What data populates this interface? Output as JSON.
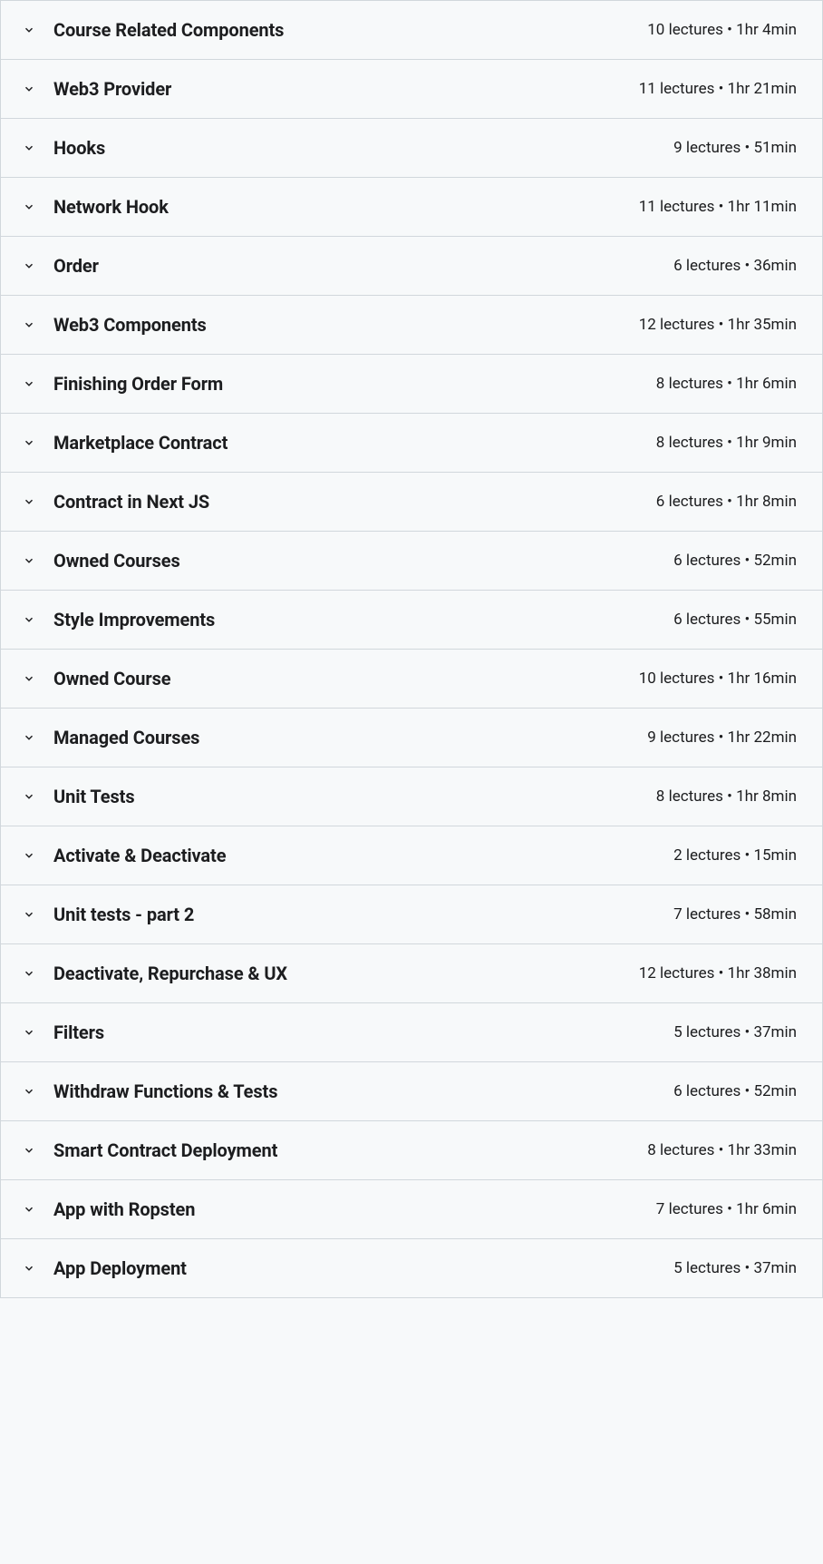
{
  "sections": [
    {
      "title": "Course Related Components",
      "meta": "10 lectures • 1hr 4min"
    },
    {
      "title": "Web3 Provider",
      "meta": "11 lectures • 1hr 21min"
    },
    {
      "title": "Hooks",
      "meta": "9 lectures • 51min"
    },
    {
      "title": "Network Hook",
      "meta": "11 lectures • 1hr 11min"
    },
    {
      "title": "Order",
      "meta": "6 lectures • 36min"
    },
    {
      "title": "Web3 Components",
      "meta": "12 lectures • 1hr 35min"
    },
    {
      "title": "Finishing Order Form",
      "meta": "8 lectures • 1hr 6min"
    },
    {
      "title": "Marketplace Contract",
      "meta": "8 lectures • 1hr 9min"
    },
    {
      "title": "Contract in Next JS",
      "meta": "6 lectures • 1hr 8min"
    },
    {
      "title": "Owned Courses",
      "meta": "6 lectures • 52min"
    },
    {
      "title": "Style Improvements",
      "meta": "6 lectures • 55min"
    },
    {
      "title": "Owned Course",
      "meta": "10 lectures • 1hr 16min"
    },
    {
      "title": "Managed Courses",
      "meta": "9 lectures • 1hr 22min"
    },
    {
      "title": "Unit Tests",
      "meta": "8 lectures • 1hr 8min"
    },
    {
      "title": "Activate & Deactivate",
      "meta": "2 lectures • 15min"
    },
    {
      "title": "Unit tests - part 2",
      "meta": "7 lectures • 58min"
    },
    {
      "title": "Deactivate, Repurchase & UX",
      "meta": "12 lectures • 1hr 38min"
    },
    {
      "title": "Filters",
      "meta": "5 lectures • 37min"
    },
    {
      "title": "Withdraw Functions & Tests",
      "meta": "6 lectures • 52min"
    },
    {
      "title": "Smart Contract Deployment",
      "meta": "8 lectures • 1hr 33min"
    },
    {
      "title": "App with Ropsten",
      "meta": "7 lectures • 1hr 6min"
    },
    {
      "title": "App Deployment",
      "meta": "5 lectures • 37min"
    }
  ]
}
